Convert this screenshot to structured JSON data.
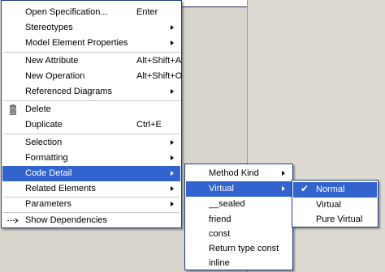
{
  "main_menu": [
    {
      "label": "Open Specification...",
      "shortcut": "Enter",
      "submenu": false
    },
    {
      "label": "Stereotypes",
      "shortcut": "",
      "submenu": true
    },
    {
      "label": "Model Element Properties",
      "shortcut": "",
      "submenu": true
    },
    {
      "label": "New Attribute",
      "shortcut": "Alt+Shift+A",
      "submenu": false
    },
    {
      "label": "New Operation",
      "shortcut": "Alt+Shift+O",
      "submenu": false
    },
    {
      "label": "Referenced Diagrams",
      "shortcut": "",
      "submenu": true
    },
    {
      "label": "Delete",
      "shortcut": "",
      "submenu": false,
      "icon": "trash-icon"
    },
    {
      "label": "Duplicate",
      "shortcut": "Ctrl+E",
      "submenu": false
    },
    {
      "label": "Selection",
      "shortcut": "",
      "submenu": true
    },
    {
      "label": "Formatting",
      "shortcut": "",
      "submenu": true
    },
    {
      "label": "Code Detail",
      "shortcut": "",
      "submenu": true,
      "highlighted": true
    },
    {
      "label": "Related Elements",
      "shortcut": "",
      "submenu": true
    },
    {
      "label": "Parameters",
      "shortcut": "",
      "submenu": true
    },
    {
      "label": "Show Dependencies",
      "shortcut": "",
      "submenu": false,
      "icon": "dependency-arrow-icon"
    }
  ],
  "code_detail_menu": [
    {
      "label": "Method Kind",
      "submenu": true
    },
    {
      "label": "Virtual",
      "submenu": true,
      "highlighted": true
    },
    {
      "label": "__sealed",
      "submenu": false
    },
    {
      "label": "friend",
      "submenu": false
    },
    {
      "label": "const",
      "submenu": false
    },
    {
      "label": "Return type const",
      "submenu": false
    },
    {
      "label": "inline",
      "submenu": false
    }
  ],
  "virtual_menu": [
    {
      "label": "Normal",
      "checked": true,
      "highlighted": true
    },
    {
      "label": "Virtual",
      "checked": false
    },
    {
      "label": "Pure Virtual",
      "checked": false
    }
  ],
  "colors": {
    "highlight": "#3363cc",
    "border": "#1f3c86"
  }
}
